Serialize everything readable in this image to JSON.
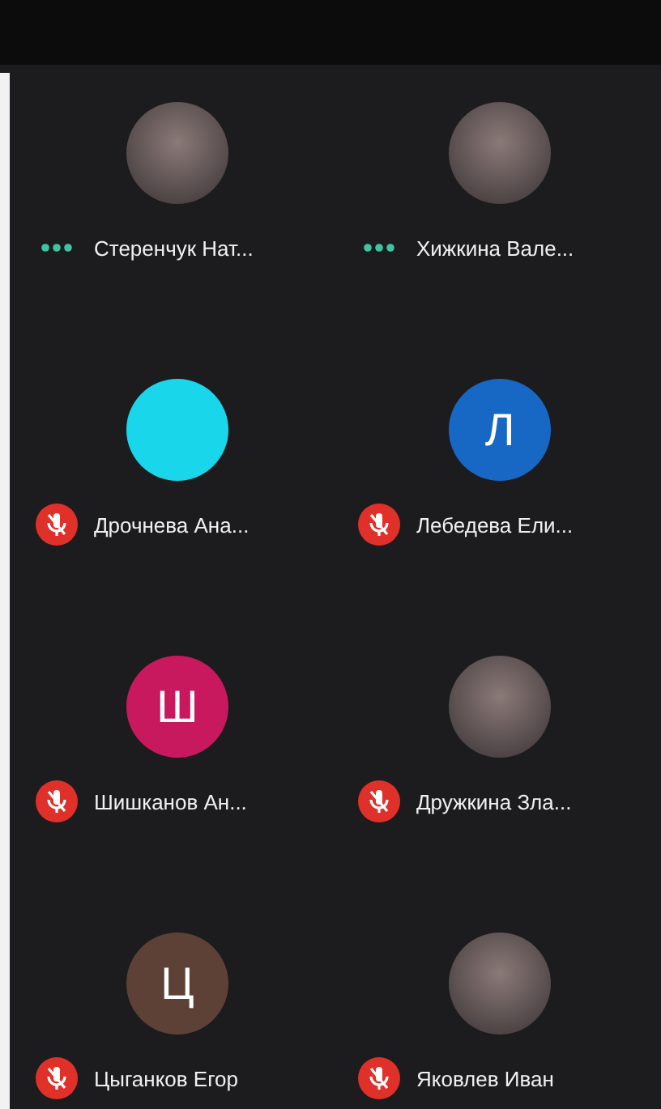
{
  "rows": [
    {
      "participants": [
        {
          "name": "Стеренчук Нат...",
          "muted": false,
          "avatar": {
            "kind": "photo"
          }
        },
        {
          "name": "Хижкина Вале...",
          "muted": false,
          "avatar": {
            "kind": "photo"
          }
        }
      ]
    },
    {
      "participants": [
        {
          "name": "Дрочнева Ана...",
          "muted": true,
          "avatar": {
            "kind": "letter",
            "color": "#19d6ea"
          }
        },
        {
          "name": "Лебедева Ели...",
          "muted": true,
          "avatar": {
            "kind": "letter",
            "letter": "Л",
            "color": "#1767c4"
          }
        }
      ]
    },
    {
      "participants": [
        {
          "name": "Шишканов Ан...",
          "muted": true,
          "avatar": {
            "kind": "letter",
            "letter": "Ш",
            "color": "#c8195e"
          }
        },
        {
          "name": "Дружкина Зла...",
          "muted": true,
          "avatar": {
            "kind": "photo"
          }
        }
      ]
    },
    {
      "participants": [
        {
          "name": "Цыганков Егор",
          "muted": true,
          "avatar": {
            "kind": "letter",
            "letter": "Ц",
            "color": "#5e4136"
          }
        },
        {
          "name": "Яковлев Иван",
          "muted": true,
          "avatar": {
            "kind": "photo"
          }
        }
      ]
    }
  ]
}
